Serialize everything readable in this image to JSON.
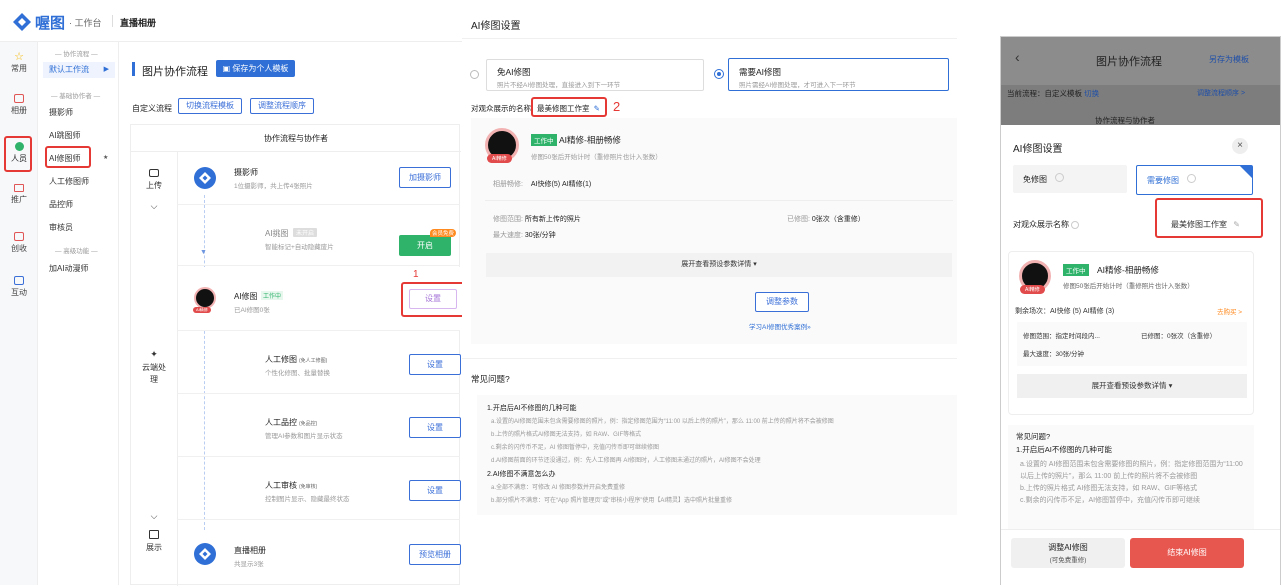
{
  "header": {
    "logo_text": "喔图",
    "workbench": "· 工作台",
    "page_title": "直播相册"
  },
  "rail": [
    {
      "label": "常用",
      "icon": "star-icon"
    },
    {
      "label": "相册",
      "icon": "album-icon"
    },
    {
      "label": "人员",
      "icon": "people-icon",
      "active": true
    },
    {
      "label": "推广",
      "icon": "promote-icon"
    },
    {
      "label": "创收",
      "icon": "revenue-icon"
    },
    {
      "label": "互动",
      "icon": "interaction-icon"
    }
  ],
  "subnav": {
    "group1": "— 协作流程 —",
    "default_flow": "默认工作流",
    "group2": "— 基础协作者 —",
    "items": [
      "摄影师",
      "AI跳图师",
      "AI修图师",
      "人工修图师",
      "品控师",
      "审核员"
    ],
    "group3": "— 高级功能 —",
    "advanced": "加AI动漫师",
    "star": "★"
  },
  "flow": {
    "title": "图片协作流程",
    "save_template": "保存为个人模板",
    "custom_label": "自定义流程",
    "switch_template": "切换流程模板",
    "adjust_order": "调整流程顺序",
    "table_header": "协作流程与协作者",
    "stage_upload": "上传",
    "stage_cloud": "云端处理",
    "stage_show": "展示",
    "rows": [
      {
        "name": "摄影师",
        "desc": "1位摄影师，共上传4张照片",
        "btn": "加摄影师"
      },
      {
        "name": "AI挑图",
        "badge": "未开启",
        "desc": "智能标记+自动隐藏废片",
        "btn": "开启",
        "vip": "会员免费"
      },
      {
        "name": "AI修图",
        "badge": "工作中",
        "desc": "已AI修图0张",
        "btn": "设置",
        "marker": "1",
        "avatar_text": "AI精修"
      },
      {
        "name": "人工修图",
        "tag": "(免人工修图)",
        "desc": "个性化修图、批量替换",
        "btn": "设置"
      },
      {
        "name": "人工品控",
        "tag": "(免品控)",
        "desc": "管理AI参数和图片显示状态",
        "btn": "设置"
      },
      {
        "name": "人工审核",
        "tag": "(免审核)",
        "desc": "控制图片显示、隐藏最终状态",
        "btn": "设置"
      },
      {
        "name": "直播相册",
        "desc": "共显示3张",
        "btn": "预览相册"
      }
    ]
  },
  "ai_settings": {
    "title": "AI修图设置",
    "opt_free_title": "免AI修图",
    "opt_free_desc": "照片不经AI修图处理，直接进入到下一环节",
    "opt_need_title": "需要AI修图",
    "opt_need_desc": "照片需经AI修图处理，才可进入下一环节",
    "display_name_label": "对观众展示的名称:",
    "display_name_value": "最美修图工作室",
    "marker": "2",
    "card_badge": "工作中",
    "card_title": "AI精修-相册畅修",
    "card_sub": "修图50张后开始计时（重修照片也计入张数）",
    "remain_label": "相册畅修:",
    "remain_value": "AI快修(5) AI精修(1)",
    "scope_label": "修图范围:",
    "scope_value": "所有新上传的照片",
    "done_label": "已修图:",
    "done_value": "0张次（含重修）",
    "speed_label": "最大速度:",
    "speed_value": "30张/分钟",
    "expand": "展开查看预设参数详情",
    "adjust_btn": "调整参数",
    "learn_link": "学习AI修图优秀案例»",
    "avatar_text": "AI精修",
    "faq_title": "常见问题?",
    "faq": [
      "1.开启后AI不修图的几种可能",
      "a.设置的AI修图范围未包含需要修图的照片，例：指定修图范围为“11:00 以后上传的照片”，那么 11:00 前上传的照片将不会被修图",
      "b.上传的照片格式AI修图无法支持，如 RAW、GIF等格式",
      "c.剩余的闪传币不足，AI 修图暂停中，充值闪传币即可继续修图",
      "d.AI修图前面的环节还没通过，例：先人工修图再 AI修图时，人工修图未通过的照片，AI修图不会处理",
      "2.AI修图不满意怎么办",
      "a.全部不满意：可修改 AI 修图参数并开启免费重修",
      "b.部分照片不满意：可在“App 照片管理页”或“审核小程序”使用【AI精灵】选中照片批量重修"
    ]
  },
  "mobile": {
    "title": "图片协作流程",
    "save": "另存为模板",
    "current_flow_label": "当前流程：",
    "current_flow_value": "自定义模板",
    "switch": "切换",
    "adjust_order": "调整流程顺序 >",
    "table_header": "协作流程与协作者",
    "sheet_title": "AI修图设置",
    "opt_free": "免修图",
    "opt_need": "需要修图",
    "display_label": "对观众展示名称",
    "display_value": "最美修图工作室",
    "card_badge": "工作中",
    "card_title": "AI精修-相册畅修",
    "card_sub": "修图50张后开始计时（重修照片也计入张数）",
    "remain": "剩余场次：AI快修 (5) AI精修 (3)",
    "buy": "去购买 >",
    "scope": "修图范围：指定时间段内...",
    "done": "已修图：0张次（含重修）",
    "speed": "最大速度：30张/分钟",
    "expand": "展开查看预设参数详情",
    "avatar_text": "AI精修",
    "faq_title": "常见问题?",
    "faq": [
      "1.开启后AI不修图的几种可能",
      "a.设置的 AI修图范围未包含需要修图的照片，例：指定修图范围为“11:00 以后上传的照片”，那么 11:00 前上传的照片将不会被修图",
      "b.上传的照片格式 AI修图无法支持，如 RAW、GIF等格式",
      "c.剩余的闪传币不足，AI修图暂停中，充值闪传币即可继续"
    ],
    "btn_adjust": "调整AI修图",
    "btn_adjust_sub": "(可免费重修)",
    "btn_end": "结束AI修图"
  }
}
